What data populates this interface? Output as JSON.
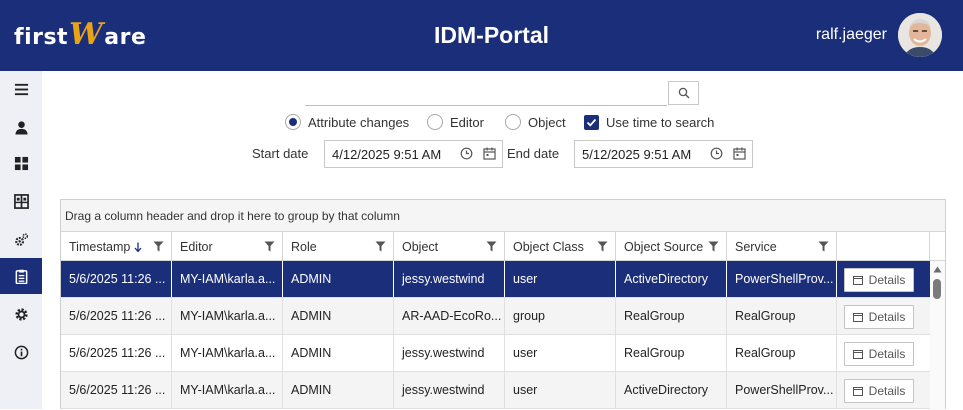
{
  "header": {
    "logo_prefix": "first",
    "logo_w": "W",
    "logo_suffix": "are",
    "title": "IDM-Portal",
    "user": "ralf.jaeger"
  },
  "sidebar": {
    "items": [
      {
        "icon": "menu-icon"
      },
      {
        "icon": "user-icon"
      },
      {
        "icon": "dashboard-icon"
      },
      {
        "icon": "inventory-icon"
      },
      {
        "icon": "gears-icon"
      },
      {
        "icon": "clipboard-icon",
        "active": true
      },
      {
        "icon": "settings-icon"
      },
      {
        "icon": "info-icon"
      }
    ]
  },
  "search": {
    "value": "",
    "placeholder": ""
  },
  "options": {
    "attribute_changes": "Attribute changes",
    "editor": "Editor",
    "object": "Object",
    "use_time": "Use time to search"
  },
  "dates": {
    "start_label": "Start date",
    "start_value": "4/12/2025 9:51 AM",
    "end_label": "End date",
    "end_value": "5/12/2025 9:51 AM"
  },
  "grid": {
    "group_hint": "Drag a column header and drop it here to group by that column",
    "columns": [
      "Timestamp",
      "Editor",
      "Role",
      "Object",
      "Object Class",
      "Object Source",
      "Service"
    ],
    "details_label": "Details",
    "rows": [
      [
        "5/6/2025 11:26 ...",
        "MY-IAM\\karla.a...",
        "ADMIN",
        "jessy.westwind",
        "user",
        "ActiveDirectory",
        "PowerShellProv..."
      ],
      [
        "5/6/2025 11:26 ...",
        "MY-IAM\\karla.a...",
        "ADMIN",
        "AR-AAD-EcoRo...",
        "group",
        "RealGroup",
        "RealGroup"
      ],
      [
        "5/6/2025 11:26 ...",
        "MY-IAM\\karla.a...",
        "ADMIN",
        "jessy.westwind",
        "user",
        "RealGroup",
        "RealGroup"
      ],
      [
        "5/6/2025 11:26 ...",
        "MY-IAM\\karla.a...",
        "ADMIN",
        "jessy.westwind",
        "user",
        "ActiveDirectory",
        "PowerShellProv..."
      ]
    ]
  },
  "colors": {
    "primary": "#1b2e7a",
    "accent": "#e8a317"
  }
}
